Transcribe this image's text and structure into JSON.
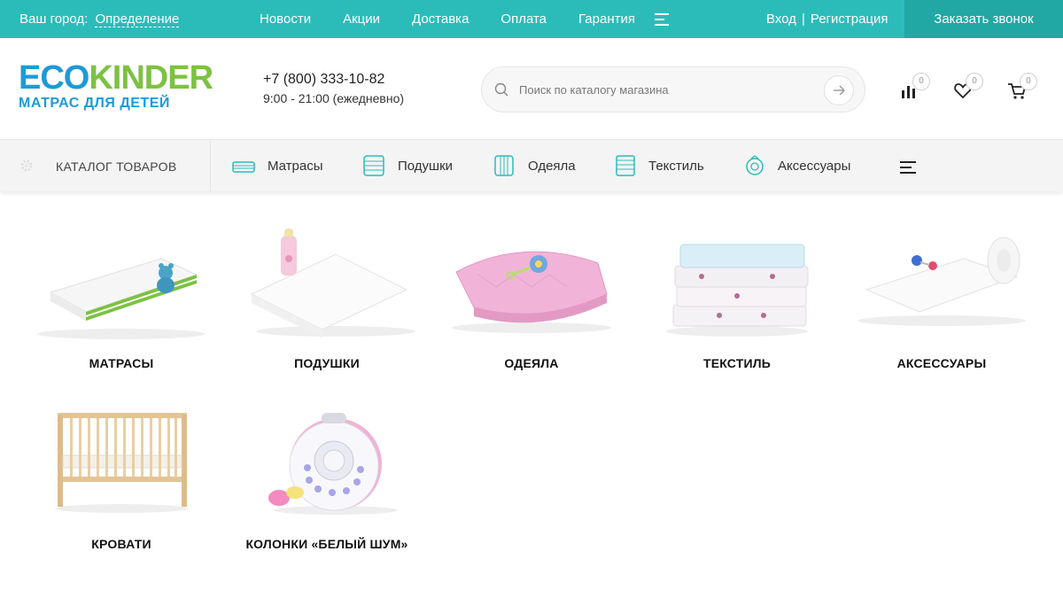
{
  "topbar": {
    "city_label": "Ваш город:",
    "city_value": "Определение",
    "nav": [
      "Новости",
      "Акции",
      "Доставка",
      "Оплата",
      "Гарантия"
    ],
    "login": "Вход",
    "separator": "|",
    "register": "Регистрация",
    "callback": "Заказать звонок"
  },
  "header": {
    "logo_part1": "ECO",
    "logo_part2": "KINDER",
    "logo_sub": "МАТРАС ДЛЯ ДЕТЕЙ",
    "phone": "+7 (800) 333-10-82",
    "hours": "9:00 - 21:00 (ежедневно)",
    "search_placeholder": "Поиск по каталогу магазина",
    "compare_count": "0",
    "favorites_count": "0",
    "cart_count": "0"
  },
  "catbar": {
    "catalog_label": "КАТАЛОГ ТОВАРОВ",
    "items": [
      "Матрасы",
      "Подушки",
      "Одеяла",
      "Текстиль",
      "Аксессуары"
    ]
  },
  "products": [
    "МАТРАСЫ",
    "ПОДУШКИ",
    "ОДЕЯЛА",
    "ТЕКСТИЛЬ",
    "АКСЕССУАРЫ",
    "КРОВАТИ",
    "КОЛОНКИ «БЕЛЫЙ ШУМ»"
  ],
  "colors": {
    "accent": "#2bbcb9",
    "accent_dark": "#21a7a4",
    "logo_blue": "#1e9ad8",
    "logo_green": "#7cc242"
  }
}
